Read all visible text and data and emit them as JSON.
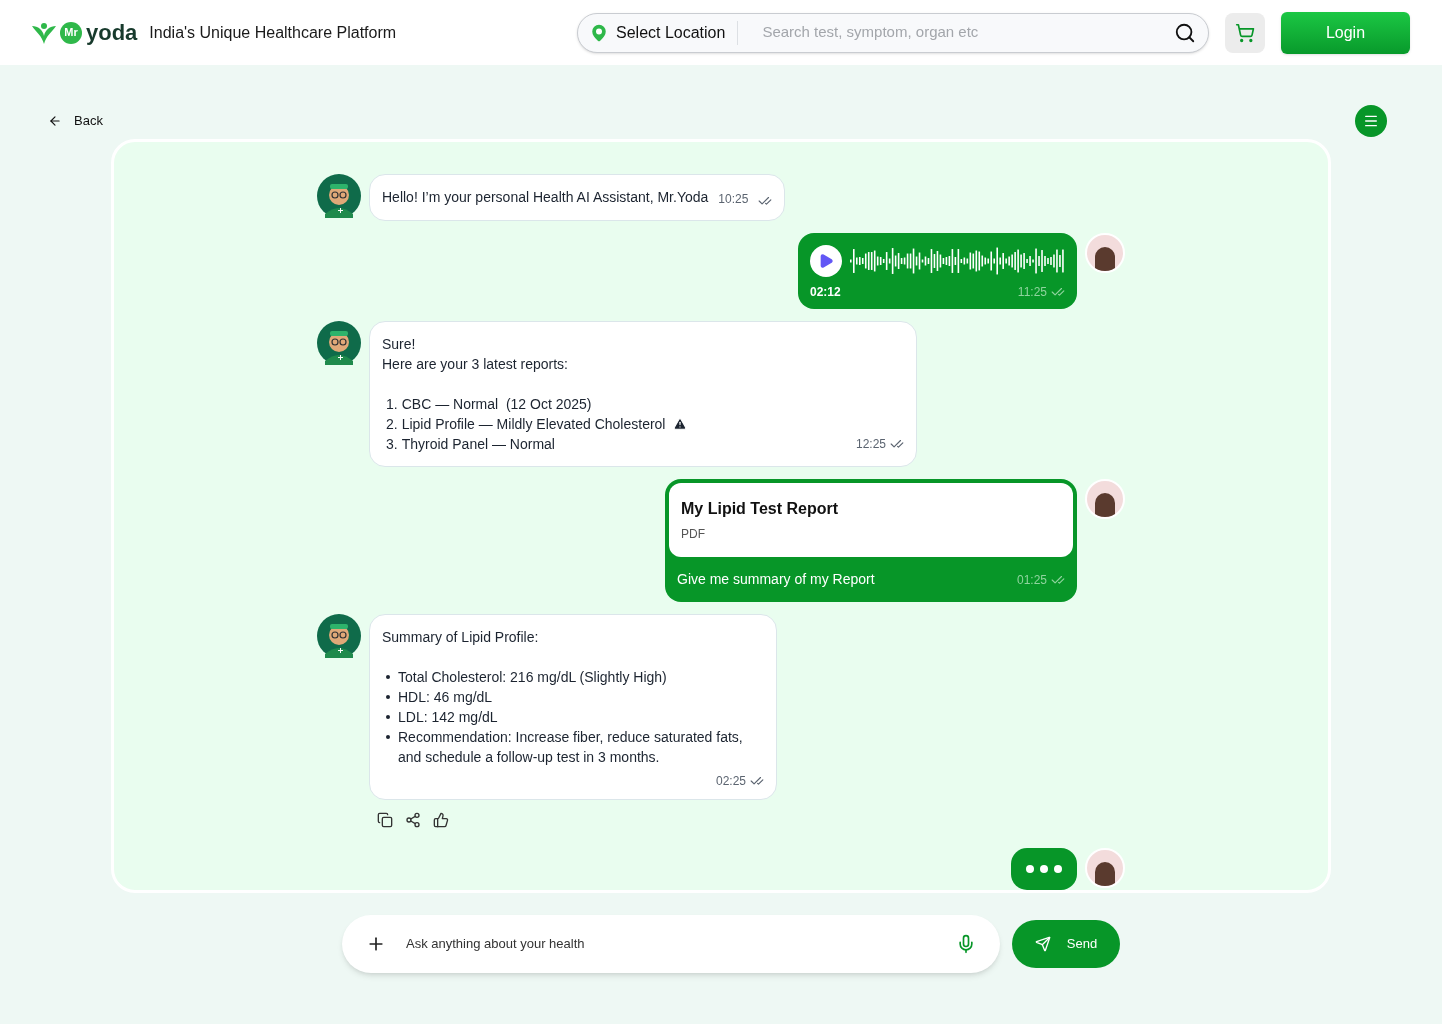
{
  "header": {
    "logo_badge": "Mr",
    "logo_word": "yoda",
    "tagline": "India's Unique Healthcare Platform",
    "location_button": "Select Location",
    "search": {
      "placeholder": "Search test, symptom, organ etc"
    },
    "login_button": "Login"
  },
  "back_link": "Back",
  "messages": [
    {
      "kind": "text",
      "text": "Hello! I’m your personal Health AI Assistant, Mr.Yoda",
      "time": "10:25"
    },
    {
      "kind": "voice",
      "duration": "02:12",
      "time": "11:25"
    },
    {
      "kind": "reports",
      "lines": [
        "Sure!",
        "Here are your 3 latest reports:"
      ],
      "items": [
        {
          "number": "1.",
          "text": "CBC — Normal  (12 Oct 2025)",
          "warning": false
        },
        {
          "number": "2.",
          "text": "Lipid Profile — Mildly Elevated Cholesterol",
          "warning": true
        },
        {
          "number": "3.",
          "text": "Thyroid Panel — Normal",
          "warning": false
        }
      ],
      "time": "12:25"
    },
    {
      "kind": "file",
      "file_title": "My Lipid Test Report",
      "file_type": "PDF",
      "text": "Give me summary of my Report",
      "time": "01:25"
    },
    {
      "kind": "summary",
      "heading": "Summary of Lipid Profile:",
      "bullets": [
        "Total Cholesterol: 216 mg/dL (Slightly High)",
        "HDL: 46 mg/dL",
        "LDL: 142 mg/dL",
        "Recommendation: Increase fiber, reduce saturated fats, and schedule a follow-up test in 3 months."
      ],
      "time": "02:25"
    },
    {
      "kind": "typing"
    }
  ],
  "composer": {
    "placeholder": "Ask anything about your health",
    "send_button": "Send"
  }
}
